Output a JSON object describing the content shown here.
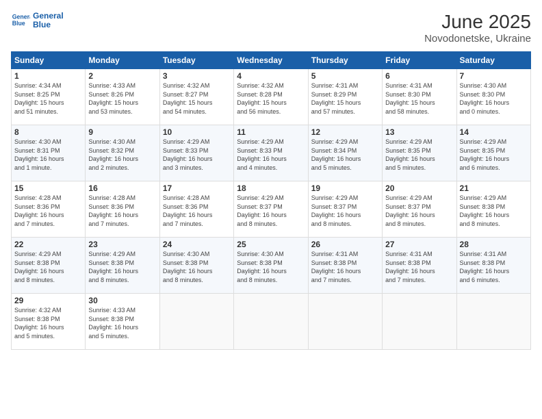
{
  "logo": {
    "line1": "General",
    "line2": "Blue"
  },
  "title": "June 2025",
  "subtitle": "Novodonetske, Ukraine",
  "weekdays": [
    "Sunday",
    "Monday",
    "Tuesday",
    "Wednesday",
    "Thursday",
    "Friday",
    "Saturday"
  ],
  "weeks": [
    [
      {
        "day": "1",
        "info": "Sunrise: 4:34 AM\nSunset: 8:25 PM\nDaylight: 15 hours\nand 51 minutes."
      },
      {
        "day": "2",
        "info": "Sunrise: 4:33 AM\nSunset: 8:26 PM\nDaylight: 15 hours\nand 53 minutes."
      },
      {
        "day": "3",
        "info": "Sunrise: 4:32 AM\nSunset: 8:27 PM\nDaylight: 15 hours\nand 54 minutes."
      },
      {
        "day": "4",
        "info": "Sunrise: 4:32 AM\nSunset: 8:28 PM\nDaylight: 15 hours\nand 56 minutes."
      },
      {
        "day": "5",
        "info": "Sunrise: 4:31 AM\nSunset: 8:29 PM\nDaylight: 15 hours\nand 57 minutes."
      },
      {
        "day": "6",
        "info": "Sunrise: 4:31 AM\nSunset: 8:30 PM\nDaylight: 15 hours\nand 58 minutes."
      },
      {
        "day": "7",
        "info": "Sunrise: 4:30 AM\nSunset: 8:30 PM\nDaylight: 16 hours\nand 0 minutes."
      }
    ],
    [
      {
        "day": "8",
        "info": "Sunrise: 4:30 AM\nSunset: 8:31 PM\nDaylight: 16 hours\nand 1 minute."
      },
      {
        "day": "9",
        "info": "Sunrise: 4:30 AM\nSunset: 8:32 PM\nDaylight: 16 hours\nand 2 minutes."
      },
      {
        "day": "10",
        "info": "Sunrise: 4:29 AM\nSunset: 8:33 PM\nDaylight: 16 hours\nand 3 minutes."
      },
      {
        "day": "11",
        "info": "Sunrise: 4:29 AM\nSunset: 8:33 PM\nDaylight: 16 hours\nand 4 minutes."
      },
      {
        "day": "12",
        "info": "Sunrise: 4:29 AM\nSunset: 8:34 PM\nDaylight: 16 hours\nand 5 minutes."
      },
      {
        "day": "13",
        "info": "Sunrise: 4:29 AM\nSunset: 8:35 PM\nDaylight: 16 hours\nand 5 minutes."
      },
      {
        "day": "14",
        "info": "Sunrise: 4:29 AM\nSunset: 8:35 PM\nDaylight: 16 hours\nand 6 minutes."
      }
    ],
    [
      {
        "day": "15",
        "info": "Sunrise: 4:28 AM\nSunset: 8:36 PM\nDaylight: 16 hours\nand 7 minutes."
      },
      {
        "day": "16",
        "info": "Sunrise: 4:28 AM\nSunset: 8:36 PM\nDaylight: 16 hours\nand 7 minutes."
      },
      {
        "day": "17",
        "info": "Sunrise: 4:28 AM\nSunset: 8:36 PM\nDaylight: 16 hours\nand 7 minutes."
      },
      {
        "day": "18",
        "info": "Sunrise: 4:29 AM\nSunset: 8:37 PM\nDaylight: 16 hours\nand 8 minutes."
      },
      {
        "day": "19",
        "info": "Sunrise: 4:29 AM\nSunset: 8:37 PM\nDaylight: 16 hours\nand 8 minutes."
      },
      {
        "day": "20",
        "info": "Sunrise: 4:29 AM\nSunset: 8:37 PM\nDaylight: 16 hours\nand 8 minutes."
      },
      {
        "day": "21",
        "info": "Sunrise: 4:29 AM\nSunset: 8:38 PM\nDaylight: 16 hours\nand 8 minutes."
      }
    ],
    [
      {
        "day": "22",
        "info": "Sunrise: 4:29 AM\nSunset: 8:38 PM\nDaylight: 16 hours\nand 8 minutes."
      },
      {
        "day": "23",
        "info": "Sunrise: 4:29 AM\nSunset: 8:38 PM\nDaylight: 16 hours\nand 8 minutes."
      },
      {
        "day": "24",
        "info": "Sunrise: 4:30 AM\nSunset: 8:38 PM\nDaylight: 16 hours\nand 8 minutes."
      },
      {
        "day": "25",
        "info": "Sunrise: 4:30 AM\nSunset: 8:38 PM\nDaylight: 16 hours\nand 8 minutes."
      },
      {
        "day": "26",
        "info": "Sunrise: 4:31 AM\nSunset: 8:38 PM\nDaylight: 16 hours\nand 7 minutes."
      },
      {
        "day": "27",
        "info": "Sunrise: 4:31 AM\nSunset: 8:38 PM\nDaylight: 16 hours\nand 7 minutes."
      },
      {
        "day": "28",
        "info": "Sunrise: 4:31 AM\nSunset: 8:38 PM\nDaylight: 16 hours\nand 6 minutes."
      }
    ],
    [
      {
        "day": "29",
        "info": "Sunrise: 4:32 AM\nSunset: 8:38 PM\nDaylight: 16 hours\nand 5 minutes."
      },
      {
        "day": "30",
        "info": "Sunrise: 4:33 AM\nSunset: 8:38 PM\nDaylight: 16 hours\nand 5 minutes."
      },
      {
        "day": "",
        "info": ""
      },
      {
        "day": "",
        "info": ""
      },
      {
        "day": "",
        "info": ""
      },
      {
        "day": "",
        "info": ""
      },
      {
        "day": "",
        "info": ""
      }
    ]
  ]
}
